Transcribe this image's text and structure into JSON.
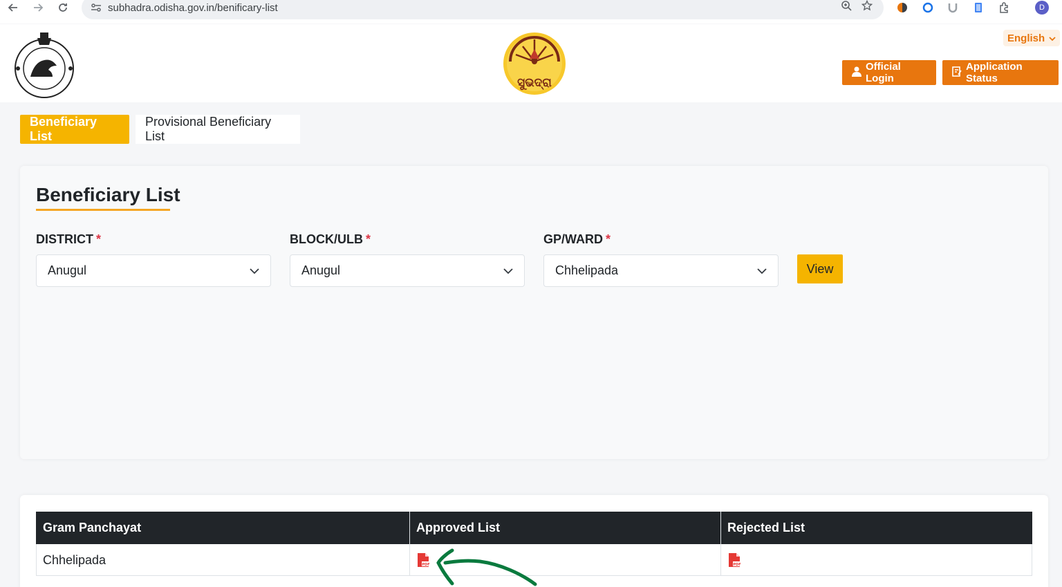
{
  "browser": {
    "url": "subhadra.odisha.gov.in/benificary-list",
    "icons": [
      "back-icon",
      "forward-icon",
      "reload-icon",
      "site-settings-icon",
      "zoom-icon",
      "bookmark-star-icon",
      "extensions-icon",
      "profile-avatar"
    ],
    "profile_initial": "D"
  },
  "header": {
    "language": "English",
    "official_login": "Official Login",
    "application_status": "Application Status",
    "logo_text": "ସୁଭଦ୍ରା",
    "colors": {
      "accent_orange": "#e8760e",
      "accent_yellow": "#f5b400",
      "dark_header": "#212529"
    }
  },
  "tabs": [
    {
      "label": "Beneficiary List",
      "active": true
    },
    {
      "label": "Provisional Beneficiary List",
      "active": false
    }
  ],
  "filter": {
    "title": "Beneficiary List",
    "fields": [
      {
        "label": "DISTRICT",
        "required_mark": "*",
        "value": "Anugul"
      },
      {
        "label": "BLOCK/ULB",
        "required_mark": "*",
        "value": "Anugul"
      },
      {
        "label": "GP/WARD",
        "required_mark": "*",
        "value": "Chhelipada"
      }
    ],
    "view_button": "View"
  },
  "table": {
    "headers": [
      "Gram Panchayat",
      "Approved List",
      "Rejected List"
    ],
    "rows": [
      {
        "gram_panchayat": "Chhelipada",
        "approved": "pdf-icon",
        "rejected": "pdf-icon"
      }
    ]
  }
}
